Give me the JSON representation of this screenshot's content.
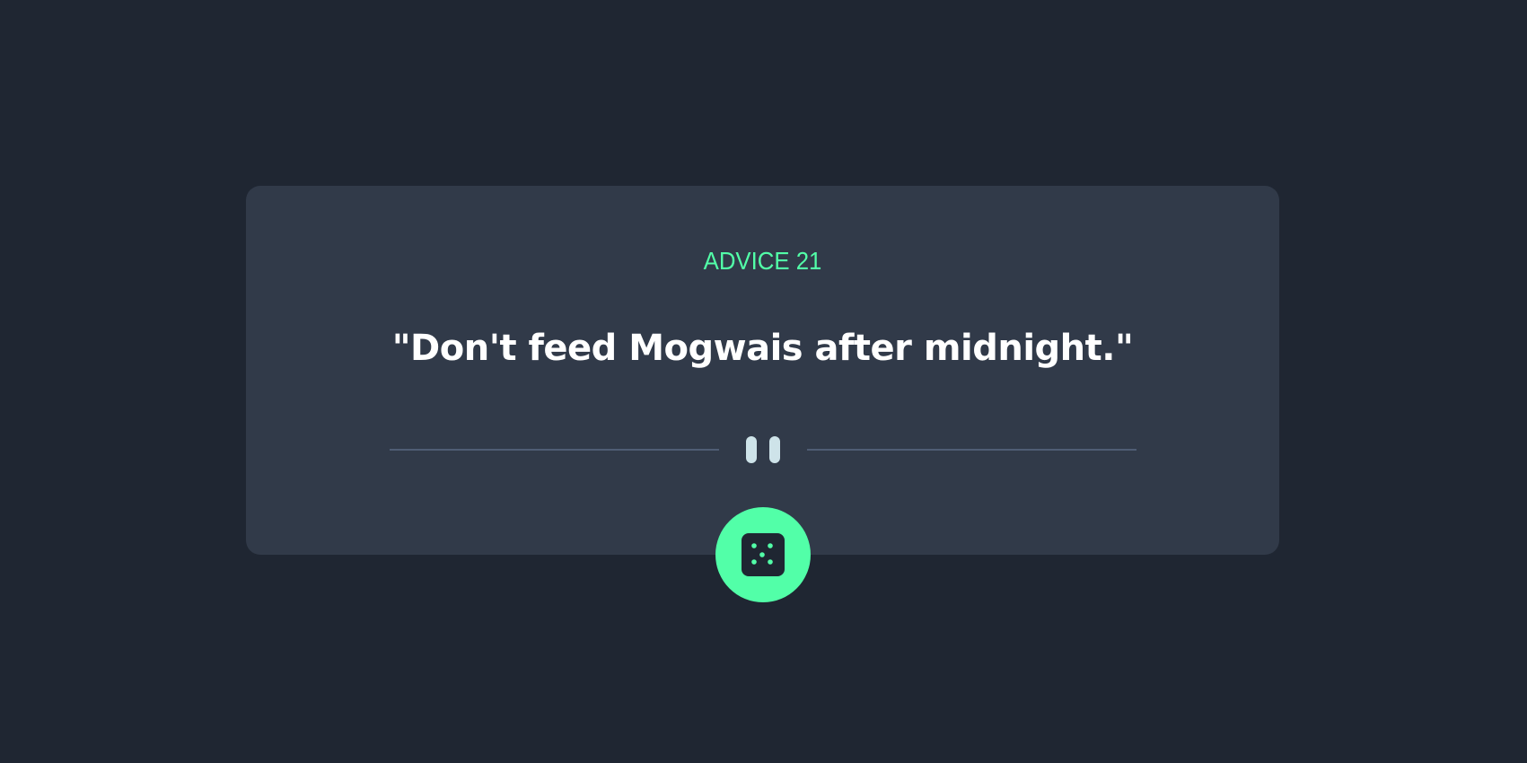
{
  "card": {
    "advice_label": "ADVICE 21",
    "quote": "\"Don't feed Mogwais after midnight.\""
  },
  "divider": {
    "icon": "pause-icon"
  },
  "button": {
    "icon": "dice-icon"
  },
  "colors": {
    "background": "#1f2632",
    "card": "#313a49",
    "accent": "#52ffa8",
    "divider_line": "#4f5d74",
    "pause_icon": "#cee3e9",
    "quote_text": "#ffffff"
  }
}
